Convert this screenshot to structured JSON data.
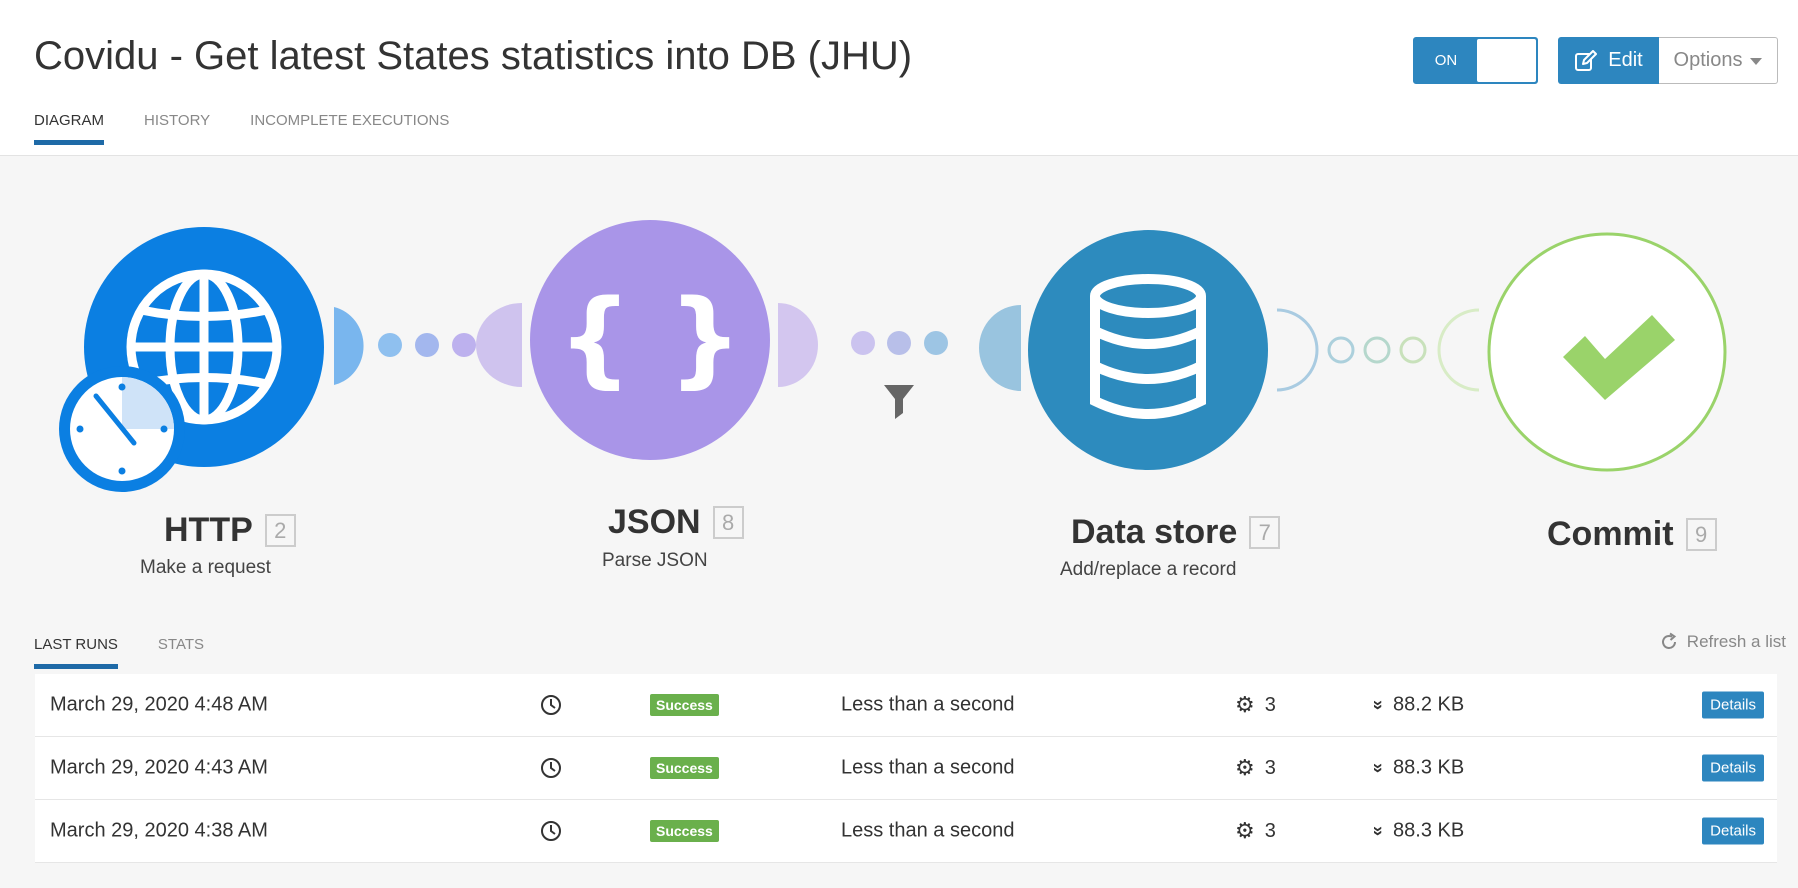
{
  "header": {
    "title": "Covidu - Get latest States statistics into DB (JHU)",
    "tabs": [
      "DIAGRAM",
      "HISTORY",
      "INCOMPLETE EXECUTIONS"
    ],
    "toggle_label": "ON",
    "edit_label": "Edit",
    "options_label": "Options"
  },
  "nodes": [
    {
      "title": "HTTP",
      "num": "2",
      "subtitle": "Make a request",
      "icon": "globe-icon",
      "color": "#0b7fe2"
    },
    {
      "title": "JSON",
      "num": "8",
      "subtitle": "Parse JSON",
      "icon": "braces-icon",
      "color": "#a995e8"
    },
    {
      "title": "Data store",
      "num": "7",
      "subtitle": "Add/replace a record",
      "icon": "database-icon",
      "color": "#2d8bbe"
    },
    {
      "title": "Commit",
      "num": "9",
      "subtitle": "",
      "icon": "checkmark-icon",
      "color": "#9ad36a"
    }
  ],
  "runs": {
    "tabs": [
      "LAST RUNS",
      "STATS"
    ],
    "refresh_label": "Refresh a list",
    "rows": [
      {
        "date": "March 29, 2020 4:48 AM",
        "status": "Success",
        "duration": "Less than a second",
        "ops": "3",
        "size": "88.2 KB",
        "details": "Details"
      },
      {
        "date": "March 29, 2020 4:43 AM",
        "status": "Success",
        "duration": "Less than a second",
        "ops": "3",
        "size": "88.3 KB",
        "details": "Details"
      },
      {
        "date": "March 29, 2020 4:38 AM",
        "status": "Success",
        "duration": "Less than a second",
        "ops": "3",
        "size": "88.3 KB",
        "details": "Details"
      }
    ]
  }
}
